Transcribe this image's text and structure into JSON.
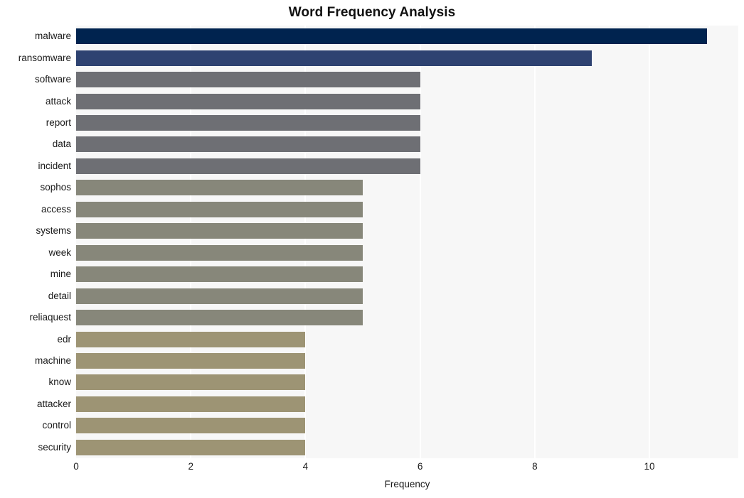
{
  "chart_data": {
    "type": "bar",
    "orientation": "horizontal",
    "title": "Word Frequency Analysis",
    "xlabel": "Frequency",
    "ylabel": "",
    "xlim": [
      0,
      11.55
    ],
    "ylim": [
      0,
      20
    ],
    "grid": true,
    "legend": false,
    "xticks": [
      "0",
      "2",
      "4",
      "6",
      "8",
      "10"
    ],
    "xtick_values": [
      0,
      2,
      4,
      6,
      8,
      10
    ],
    "categories": [
      "malware",
      "ransomware",
      "software",
      "attack",
      "report",
      "data",
      "incident",
      "sophos",
      "access",
      "systems",
      "week",
      "mine",
      "detail",
      "reliaquest",
      "edr",
      "machine",
      "know",
      "attacker",
      "control",
      "security"
    ],
    "values": [
      11,
      9,
      6,
      6,
      6,
      6,
      6,
      5,
      5,
      5,
      5,
      5,
      5,
      5,
      4,
      4,
      4,
      4,
      4,
      4
    ],
    "bar_colors": [
      "#00234f",
      "#2e4271",
      "#6e6f74",
      "#6e6f74",
      "#6e6f74",
      "#6e6f74",
      "#6e6f74",
      "#87877a",
      "#87877a",
      "#87877a",
      "#87877a",
      "#87877a",
      "#87877a",
      "#87877a",
      "#9d9474",
      "#9d9474",
      "#9d9474",
      "#9d9474",
      "#9d9474",
      "#9d9474"
    ],
    "plot_background": "#f7f7f7",
    "gridline_color": "#ffffff",
    "page_background": "#ffffff",
    "text_color": "#1a1a1a"
  }
}
